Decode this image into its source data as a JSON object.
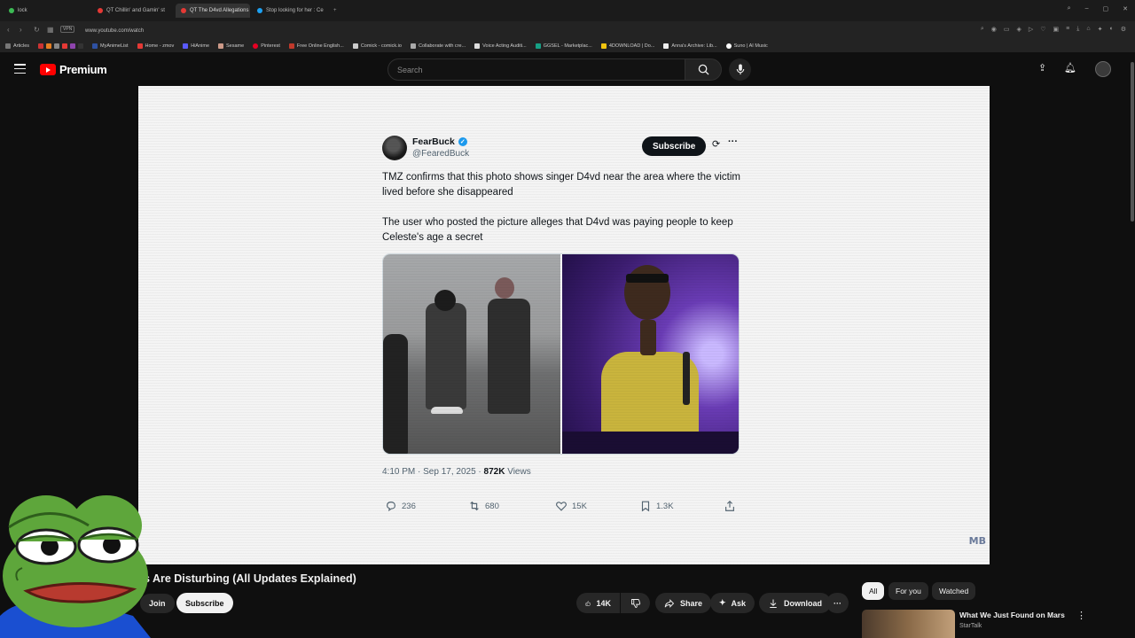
{
  "browser": {
    "tabs": [
      {
        "label": "lock",
        "color": "#3cba54"
      },
      {
        "label": "QT Chillin' and Gamin' st",
        "color": "#e53935"
      },
      {
        "label": "QT The D4vd Allegations",
        "color": "#e53935",
        "active": true
      },
      {
        "label": "Stop looking for her : Ce",
        "color": "#1da1f2"
      }
    ],
    "url": "www.youtube.com/watch",
    "vpn_label": "VPN",
    "bookmarks": [
      "Articles",
      "MyAnimeList",
      "Home - zmov",
      "HiAnime",
      "Sesame",
      "Pinterest",
      "Free Online English...",
      "Comick - comick.io",
      "Collaborate with cre...",
      "Voice Acting Auditi...",
      "GGSEL - Marketplac...",
      "4DOWNLOAD | Do...",
      "Anna's Archive: Lib...",
      "Suno | AI Music"
    ]
  },
  "youtube": {
    "logo_text": "Premium",
    "search_placeholder": "Search"
  },
  "tweet": {
    "author_name": "FearBuck",
    "author_handle": "@FearedBuck",
    "subscribe_label": "Subscribe",
    "paragraph_1": "TMZ confirms that this photo shows singer D4vd near the area where the victim lived before she disappeared",
    "paragraph_2": "The user who posted the picture alleges that D4vd was paying people to keep Celeste's age a secret",
    "time": "4:10 PM",
    "date": "Sep 17, 2025",
    "views_count": "872K",
    "views_label": "Views",
    "replies": "236",
    "reposts": "680",
    "likes": "15K",
    "bookmarks": "1.3K"
  },
  "video": {
    "watermark": "MB",
    "title": "s Are Disturbing (All Updates Explained)",
    "join_label": "Join",
    "subscribe_label": "Subscribe",
    "likes": "14K",
    "share_label": "Share",
    "ask_label": "Ask",
    "download_label": "Download"
  },
  "sidebar": {
    "chips": [
      "All",
      "For you",
      "Watched"
    ],
    "rec_title": "What We Just Found on Mars",
    "rec_channel": "StarTalk"
  },
  "colors": {
    "yt_red": "#ff0000",
    "twitter_blue": "#1d9bf0",
    "dark_bg": "#0f0f0f"
  }
}
